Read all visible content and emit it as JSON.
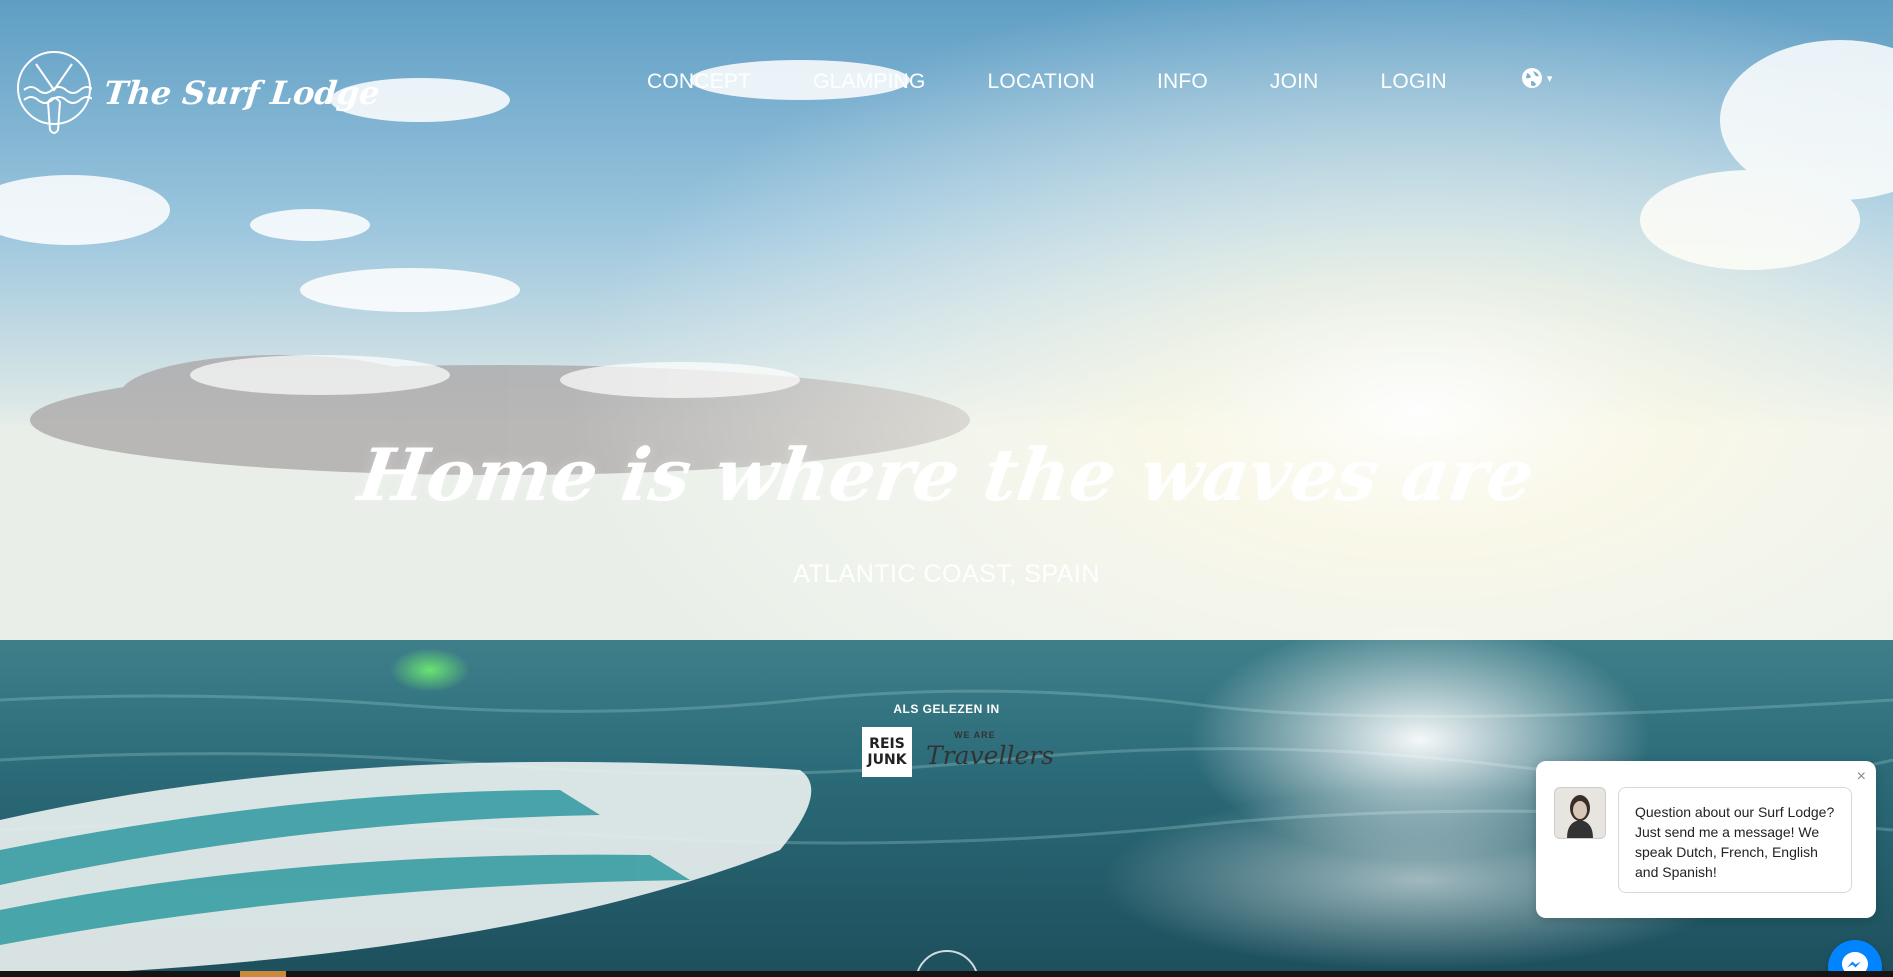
{
  "brand": {
    "name": "The Surf Lodge",
    "logo_icon": "surf-lodge-emblem-icon"
  },
  "nav": {
    "items": [
      {
        "label": "CONCEPT"
      },
      {
        "label": "GLAMPING"
      },
      {
        "label": "LOCATION"
      },
      {
        "label": "INFO"
      },
      {
        "label": "JOIN"
      },
      {
        "label": "LOGIN"
      }
    ],
    "language_icon": "globe-icon",
    "language_caret": "▾"
  },
  "hero": {
    "headline": "Home is where the waves are",
    "subheadline": "ATLANTIC COAST, SPAIN",
    "press_label": "ALS GELEZEN IN",
    "press_logos": [
      {
        "line1": "REIS",
        "line2": "JUNK"
      },
      {
        "top": "WE ARE",
        "word": "Travellers"
      }
    ]
  },
  "chat": {
    "message": "Question about our Surf Lodge? Just send me a message! We speak Dutch, French, English and Spanish!",
    "close_label": "×",
    "launcher_icon": "messenger-icon"
  },
  "colors": {
    "nav_text": "#ffffff",
    "messenger_blue": "#0084ff",
    "chat_bg": "#ffffff"
  }
}
